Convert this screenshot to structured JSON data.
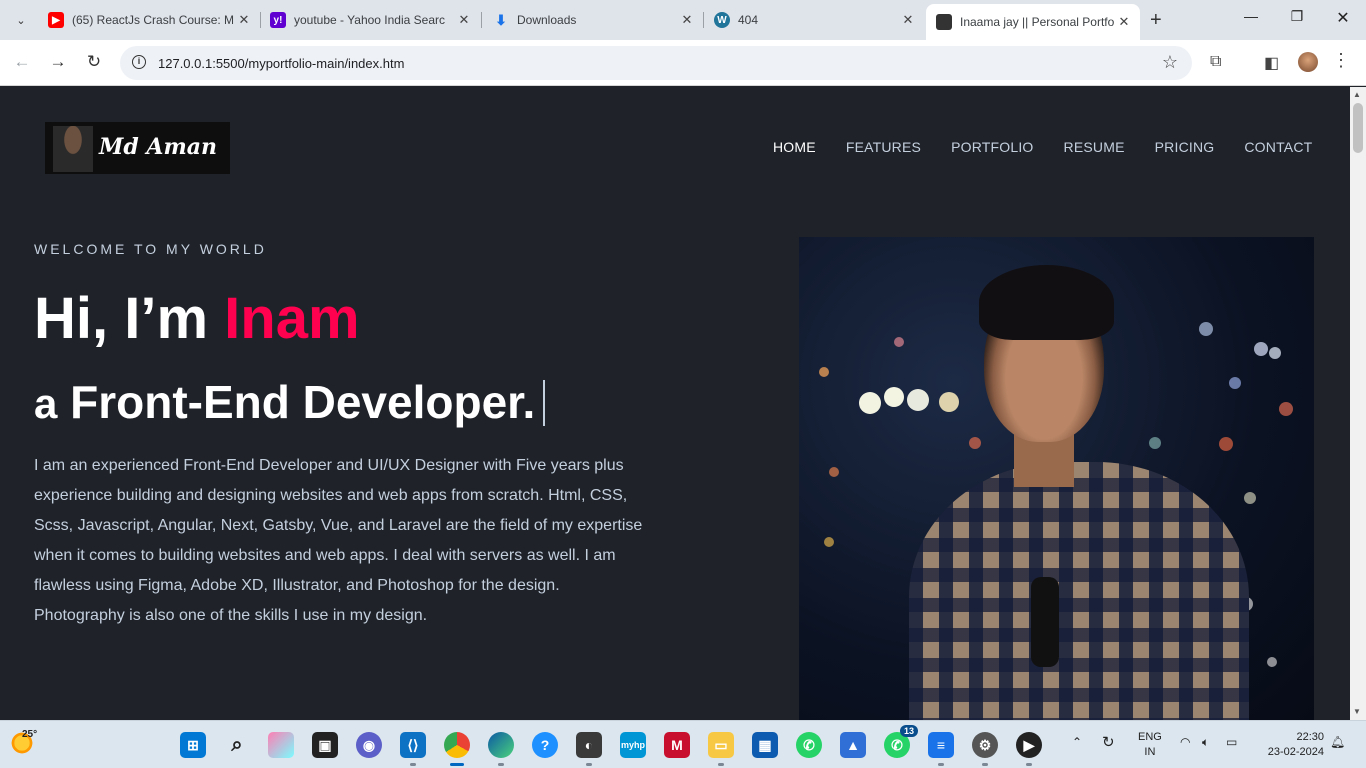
{
  "browser": {
    "tabs": [
      {
        "title": "(65) ReactJs Crash Course: M",
        "icon": "youtube-icon",
        "color": "#ff0000"
      },
      {
        "title": "youtube - Yahoo India Searc",
        "icon": "yahoo-icon",
        "color": "#6001d2"
      },
      {
        "title": "Downloads",
        "icon": "download-icon",
        "color": "#1a73e8"
      },
      {
        "title": "404",
        "icon": "wordpress-icon",
        "color": "#21759b"
      },
      {
        "title": "Inaama jay || Personal Portfo",
        "icon": "favicon-photo-icon",
        "color": "#222222"
      }
    ],
    "url": "127.0.0.1:5500/myportfolio-main/index.htm"
  },
  "site": {
    "logo_text": "Md Aman",
    "nav": [
      "HOME",
      "FEATURES",
      "PORTFOLIO",
      "RESUME",
      "PRICING",
      "CONTACT"
    ],
    "welcome": "WELCOME TO MY WORLD",
    "hi_prefix": "Hi, I’m ",
    "name": "Inam",
    "role_prefix": "a",
    "role": "Front-End Developer.",
    "description": "I am an experienced Front-End Developer and UI/UX Designer with Five years plus experience building and designing websites and web apps from scratch. Html, CSS, Scss, Javascript, Angular, Next, Gatsby, Vue, and Laravel are the field of my expertise when it comes to building websites and web apps. I deal with servers as well. I am flawless using Figma, Adobe XD, Illustrator, and Photoshop for the design. Photography is also one of the skills I use in my design.",
    "accent_color": "#ff014f"
  },
  "taskbar": {
    "temperature": "25°",
    "whatsapp_badge": "13",
    "language": "ENG",
    "region": "IN",
    "time": "22:30",
    "date": "23-02-2024"
  }
}
